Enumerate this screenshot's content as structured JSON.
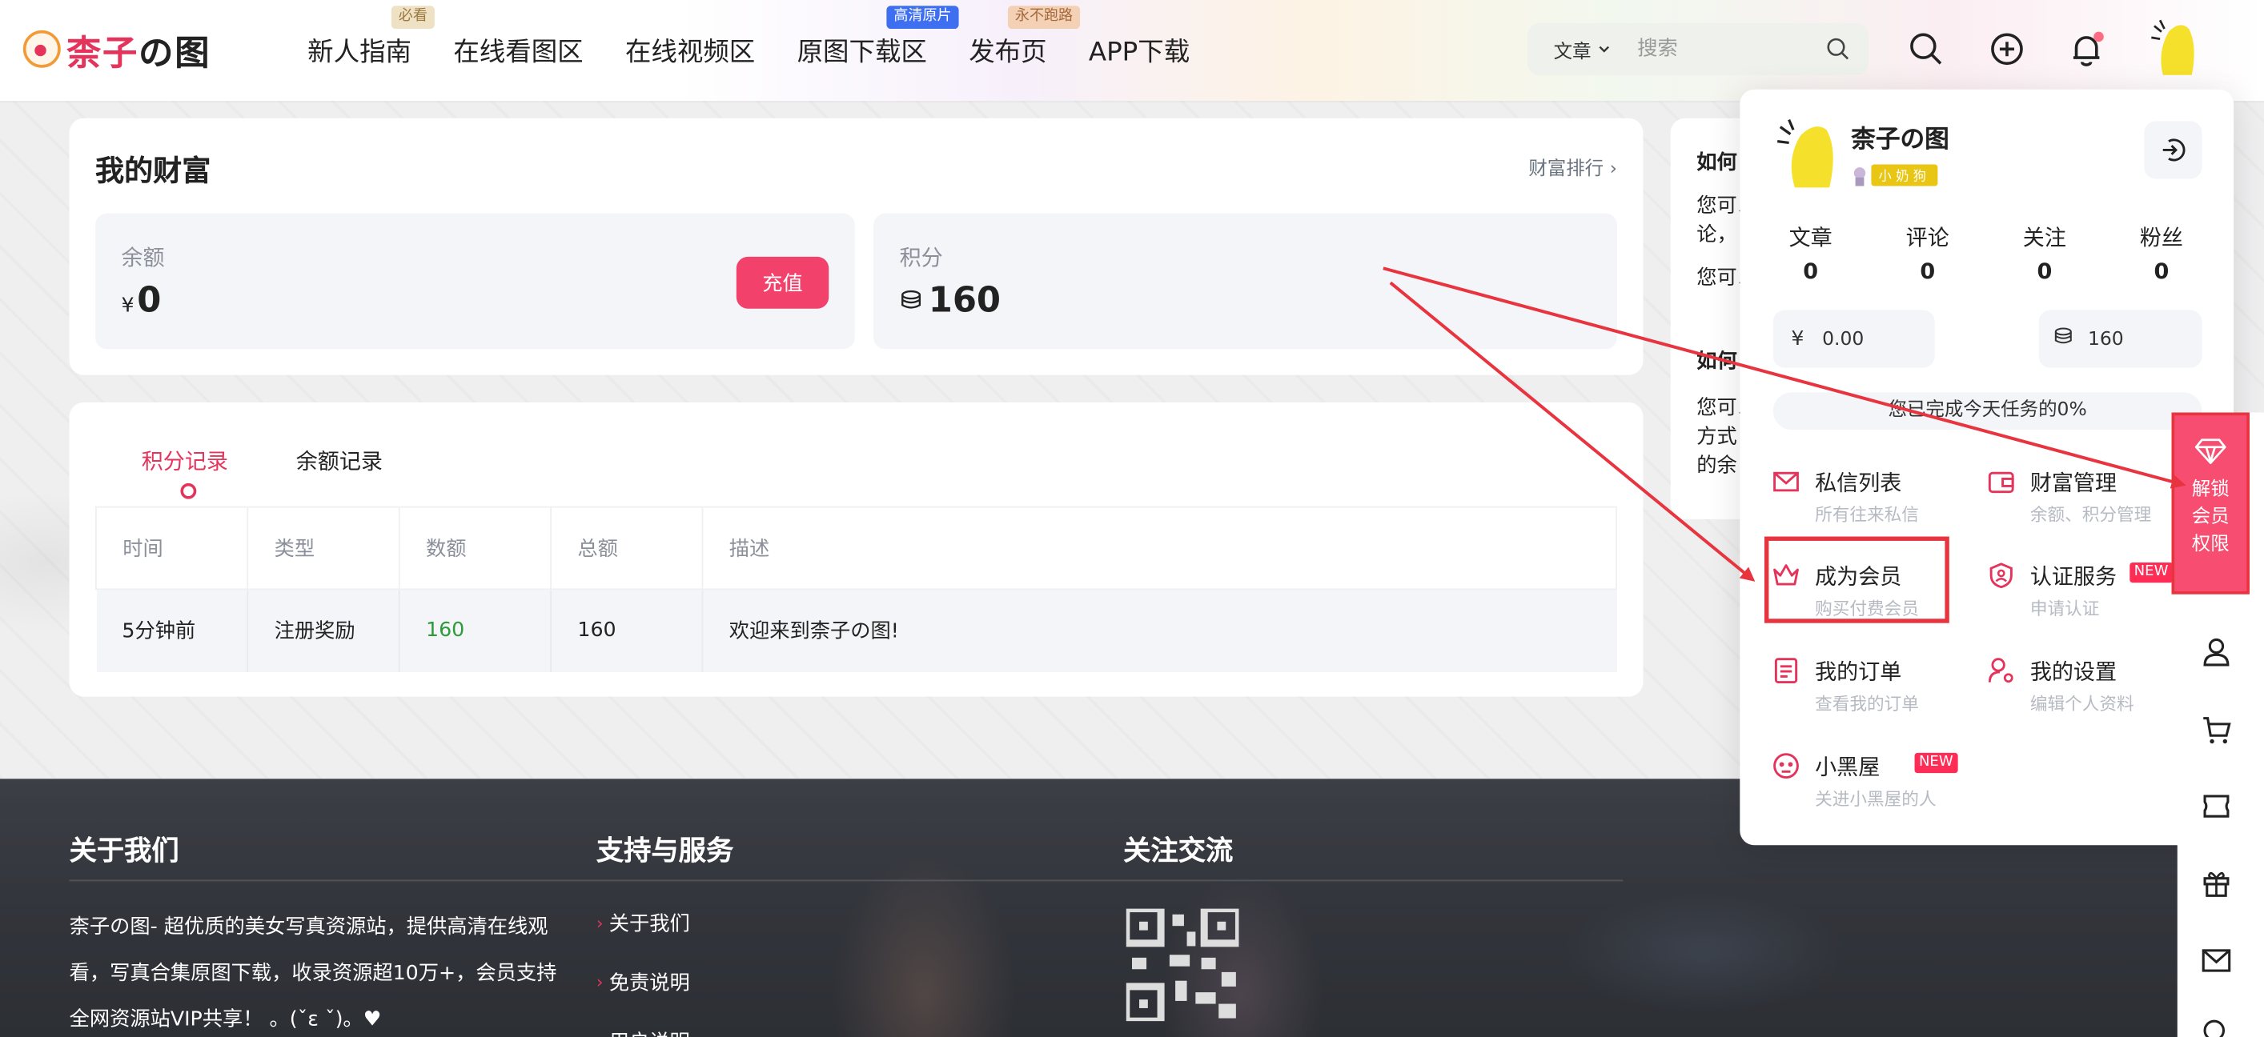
{
  "header": {
    "logo": {
      "part1": "柰子",
      "part2": "の图"
    },
    "nav": [
      {
        "label": "新人指南",
        "badge": "必看"
      },
      {
        "label": "在线看图区",
        "badge": ""
      },
      {
        "label": "在线视频区",
        "badge": ""
      },
      {
        "label": "原图下载区",
        "badge": "高清原片"
      },
      {
        "label": "发布页",
        "badge": "永不跑路"
      },
      {
        "label": "APP下载",
        "badge": ""
      }
    ],
    "search": {
      "category": "文章",
      "placeholder": "搜索"
    }
  },
  "wealth": {
    "title": "我的财富",
    "rank_link": "财富排行",
    "balance": {
      "label": "余额",
      "currency": "¥",
      "value": "0",
      "button": "充值"
    },
    "points": {
      "label": "积分",
      "value": "160"
    }
  },
  "records": {
    "tabs": [
      "积分记录",
      "余额记录"
    ],
    "columns": [
      "时间",
      "类型",
      "数额",
      "总额",
      "描述"
    ],
    "rows": [
      {
        "time": "5分钟前",
        "type": "注册奖励",
        "amount": "160",
        "total": "160",
        "desc": "欢迎来到柰子の图!"
      }
    ]
  },
  "howto": {
    "title1": "如何",
    "lines1": [
      "您可以",
      "论，",
      "您可以"
    ],
    "title2": "如何",
    "lines2": [
      "您可以",
      "方式",
      "的余"
    ]
  },
  "user_panel": {
    "name": "柰子の图",
    "level": "小奶狗",
    "stats": [
      {
        "label": "文章",
        "value": "0"
      },
      {
        "label": "评论",
        "value": "0"
      },
      {
        "label": "关注",
        "value": "0"
      },
      {
        "label": "粉丝",
        "value": "0"
      }
    ],
    "balance": {
      "symbol": "¥",
      "value": "0.00"
    },
    "points": {
      "value": "160"
    },
    "task": "您已完成今天任务的0%",
    "menu": [
      {
        "title": "私信列表",
        "sub": "所有往来私信",
        "new": ""
      },
      {
        "title": "财富管理",
        "sub": "余额、积分管理",
        "new": ""
      },
      {
        "title": "成为会员",
        "sub": "购买付费会员",
        "new": ""
      },
      {
        "title": "认证服务",
        "sub": "申请认证",
        "new": "NEW"
      },
      {
        "title": "我的订单",
        "sub": "查看我的订单",
        "new": ""
      },
      {
        "title": "我的设置",
        "sub": "编辑个人资料",
        "new": ""
      },
      {
        "title": "小黑屋",
        "sub": "关进小黑屋的人",
        "new": "NEW"
      }
    ]
  },
  "sidebar": {
    "unlock_label": "解锁会员权限"
  },
  "footer": {
    "about_title": "关于我们",
    "about_text": "柰子の图- 超优质的美女写真资源站，提供高清在线观看，写真合集原图下载，收录资源超10万+，会员支持全网资源站VIP共享！ 。(ˇε ˇ)。♥",
    "support_title": "支持与服务",
    "support_links": [
      "关于我们",
      "免责说明",
      "用户说明"
    ],
    "follow_title": "关注交流"
  },
  "colors": {
    "accent": "#e4345b",
    "annotation": "#e8343f",
    "recharge": "#f2416b",
    "positive": "#2e9a3a"
  }
}
